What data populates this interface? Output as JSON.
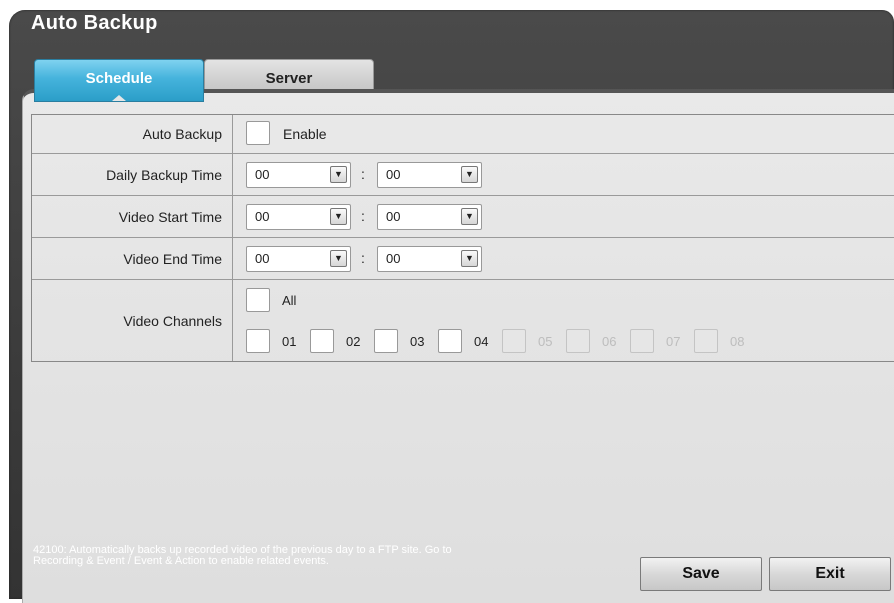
{
  "window": {
    "title": "Auto Backup"
  },
  "tabs": [
    {
      "label": "Schedule",
      "active": true
    },
    {
      "label": "Server",
      "active": false
    }
  ],
  "rows": {
    "auto_backup": {
      "label": "Auto Backup",
      "enable_label": "Enable",
      "checked": false
    },
    "daily_backup_time": {
      "label": "Daily Backup Time",
      "hour": "00",
      "separator": ":",
      "minute": "00"
    },
    "video_start_time": {
      "label": "Video Start Time",
      "hour": "00",
      "separator": ":",
      "minute": "00"
    },
    "video_end_time": {
      "label": "Video End Time",
      "hour": "00",
      "separator": ":",
      "minute": "00"
    },
    "video_channels": {
      "label": "Video Channels",
      "all_label": "All",
      "channels": [
        {
          "label": "01",
          "enabled": true
        },
        {
          "label": "02",
          "enabled": true
        },
        {
          "label": "03",
          "enabled": true
        },
        {
          "label": "04",
          "enabled": true
        },
        {
          "label": "05",
          "enabled": false
        },
        {
          "label": "06",
          "enabled": false
        },
        {
          "label": "07",
          "enabled": false
        },
        {
          "label": "08",
          "enabled": false
        }
      ]
    }
  },
  "icons": {
    "dropdown": "chevron-down-icon"
  },
  "status_text": "42100: Automatically backs up recorded video of the previous day to a FTP site.  Go to Recording & Event / Event & Action to enable related events.",
  "buttons": {
    "save": "Save",
    "exit": "Exit"
  },
  "colors": {
    "accent": "#45b3dc",
    "window_bg": "#3b3b3b",
    "panel_bg": "#e4e4e4"
  }
}
